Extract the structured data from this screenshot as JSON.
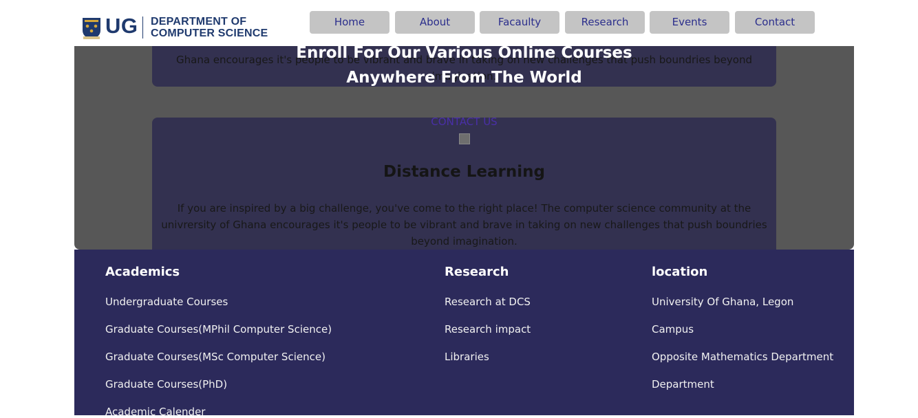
{
  "header": {
    "logo": {
      "short": "UG",
      "line1": "DEPARTMENT OF",
      "line2": "COMPUTER SCIENCE"
    },
    "nav": [
      "Home",
      "About",
      "Facaulty",
      "Research",
      "Events",
      "Contact"
    ]
  },
  "hero": {
    "card_text_1": "Ghana encourages it's people to be vibrant and brave in taking on new challenges that push boundries beyond imagination.",
    "enroll_line1": "Enroll For Our Various Online Courses",
    "enroll_line2": "Anywhere From The World",
    "contact": "CONTACT US",
    "card_title": "Distance Learning",
    "card_text_2": "If you are inspired by a big challenge, you've come to the right place! The computer science community at the univrersity of Ghana encourages it's people to be vibrant and brave in taking on new challenges that push boundries beyond imagination."
  },
  "footer": {
    "academics": {
      "title": "Academics",
      "links": [
        "Undergraduate Courses",
        "Graduate Courses(MPhil Computer Science)",
        "Graduate Courses(MSc Computer Science)",
        "Graduate Courses(PhD)",
        "Academic Calender"
      ]
    },
    "research": {
      "title": "Research",
      "links": [
        "Research at DCS",
        "Research impact",
        "Libraries"
      ]
    },
    "location": {
      "title": "location",
      "links": [
        "University Of Ghana, Legon",
        "Campus",
        "Opposite Mathematics Department",
        "Department"
      ]
    }
  },
  "colors": {
    "brand": "#1f3a6e",
    "footer_bg": "#2c2a5b",
    "nav_btn": "#c4c4c4",
    "nav_text": "#2b2e8c",
    "overlay": "#575757"
  }
}
